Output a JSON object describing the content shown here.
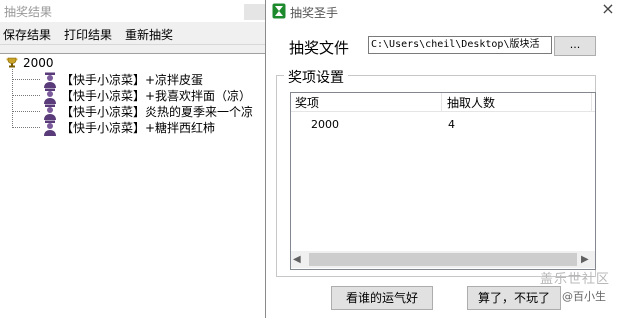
{
  "back_window": {
    "title": "抽奖结果",
    "menu": [
      "保存结果",
      "打印结果",
      "重新抽奖"
    ],
    "tree": {
      "root_label": "2000",
      "root_icon": "trophy-icon",
      "node_icon": "person-icon",
      "items": [
        "【快手小凉菜】+凉拌皮蛋",
        "【快手小凉菜】+我喜欢拌面（凉）",
        "【快手小凉菜】炎热的夏季来一个凉",
        "【快手小凉菜】+糖拌西红柿"
      ]
    }
  },
  "front_window": {
    "title": "抽奖圣手",
    "app_icon": "hourglass-icon",
    "close_label": "×",
    "file_label": "抽奖文件",
    "file_path": "C:\\Users\\cheil\\Desktop\\版块活",
    "browse_label": "...",
    "group_label": "奖项设置",
    "table": {
      "columns": [
        "奖项",
        "抽取人数"
      ],
      "rows": [
        {
          "prize": "2000",
          "count": "4"
        }
      ]
    },
    "scroll_left": "◀",
    "scroll_right": "▶",
    "buttons": {
      "lucky": "看谁的运气好",
      "quit": "算了，不玩了"
    }
  },
  "watermark": {
    "line1": "盖乐世社区",
    "line2": "@百小生"
  },
  "colors": {
    "window_bg": "#f0f0f0",
    "accent_green": "#1e8a2e",
    "trophy_gold": "#b8860b"
  }
}
